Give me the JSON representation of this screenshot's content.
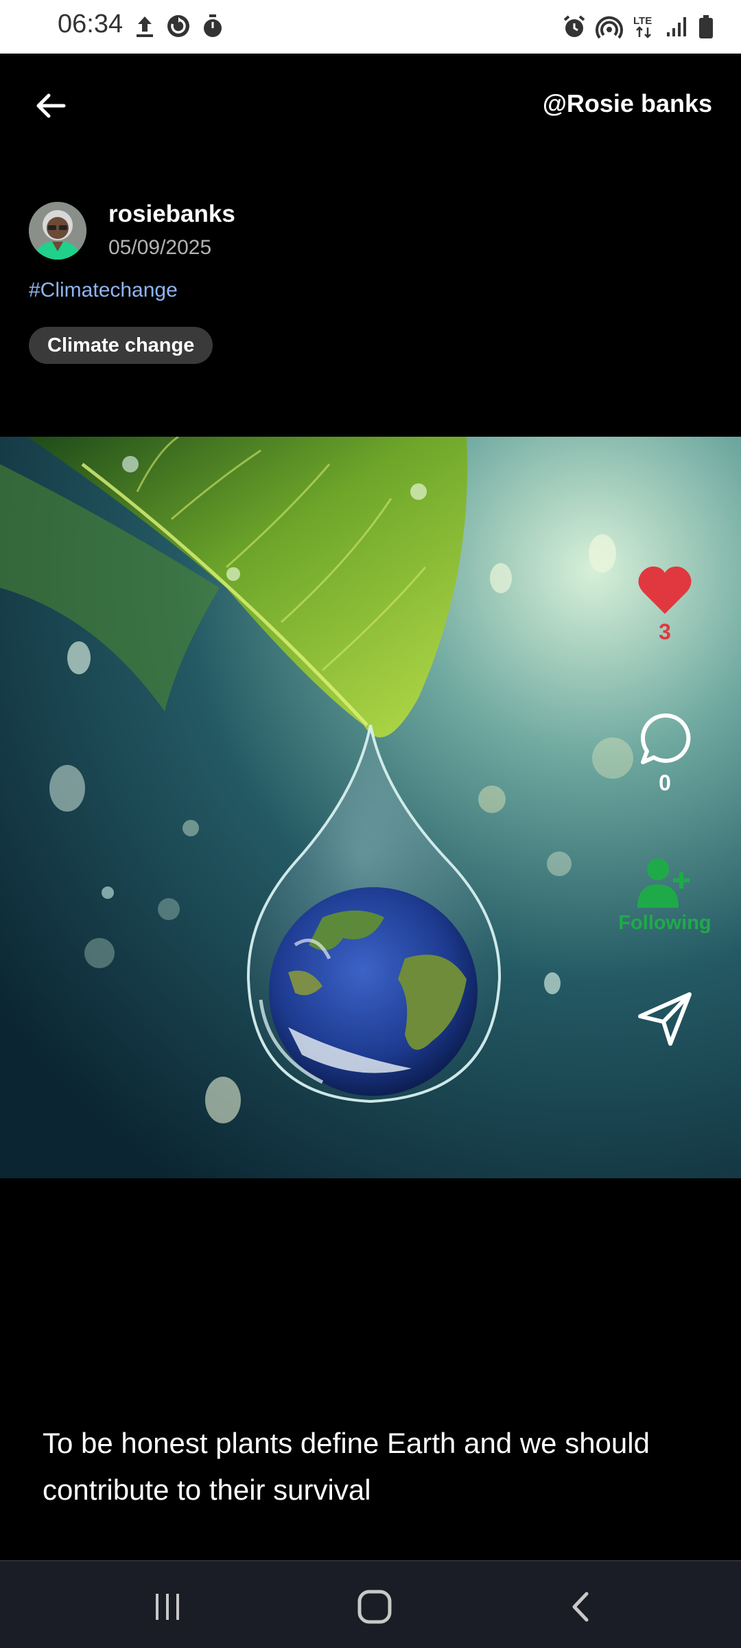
{
  "status_bar": {
    "time": "06:34",
    "left_icons": [
      "upload-icon",
      "sync-icon",
      "timer-icon"
    ],
    "right_icons": [
      "alarm-icon",
      "hotspot-icon",
      "lte-icon",
      "signal-icon",
      "battery-icon"
    ],
    "network_label": "LTE"
  },
  "header": {
    "back_icon": "arrow-left-icon",
    "handle": "@Rosie banks"
  },
  "post": {
    "author": "rosiebanks",
    "date": "05/09/2025",
    "hashtag": "#Climatechange",
    "topic": "Climate change",
    "image_description_icon": "earth-in-water-drop-image",
    "caption": "To be honest plants define Earth and we should contribute to their survival"
  },
  "actions": {
    "like_count": "3",
    "comment_count": "0",
    "follow_label": "Following",
    "like_color": "#e0383e",
    "follow_color": "#1faa4a"
  },
  "nav": {
    "icons": [
      "recent-apps-icon",
      "home-icon",
      "back-icon"
    ]
  }
}
